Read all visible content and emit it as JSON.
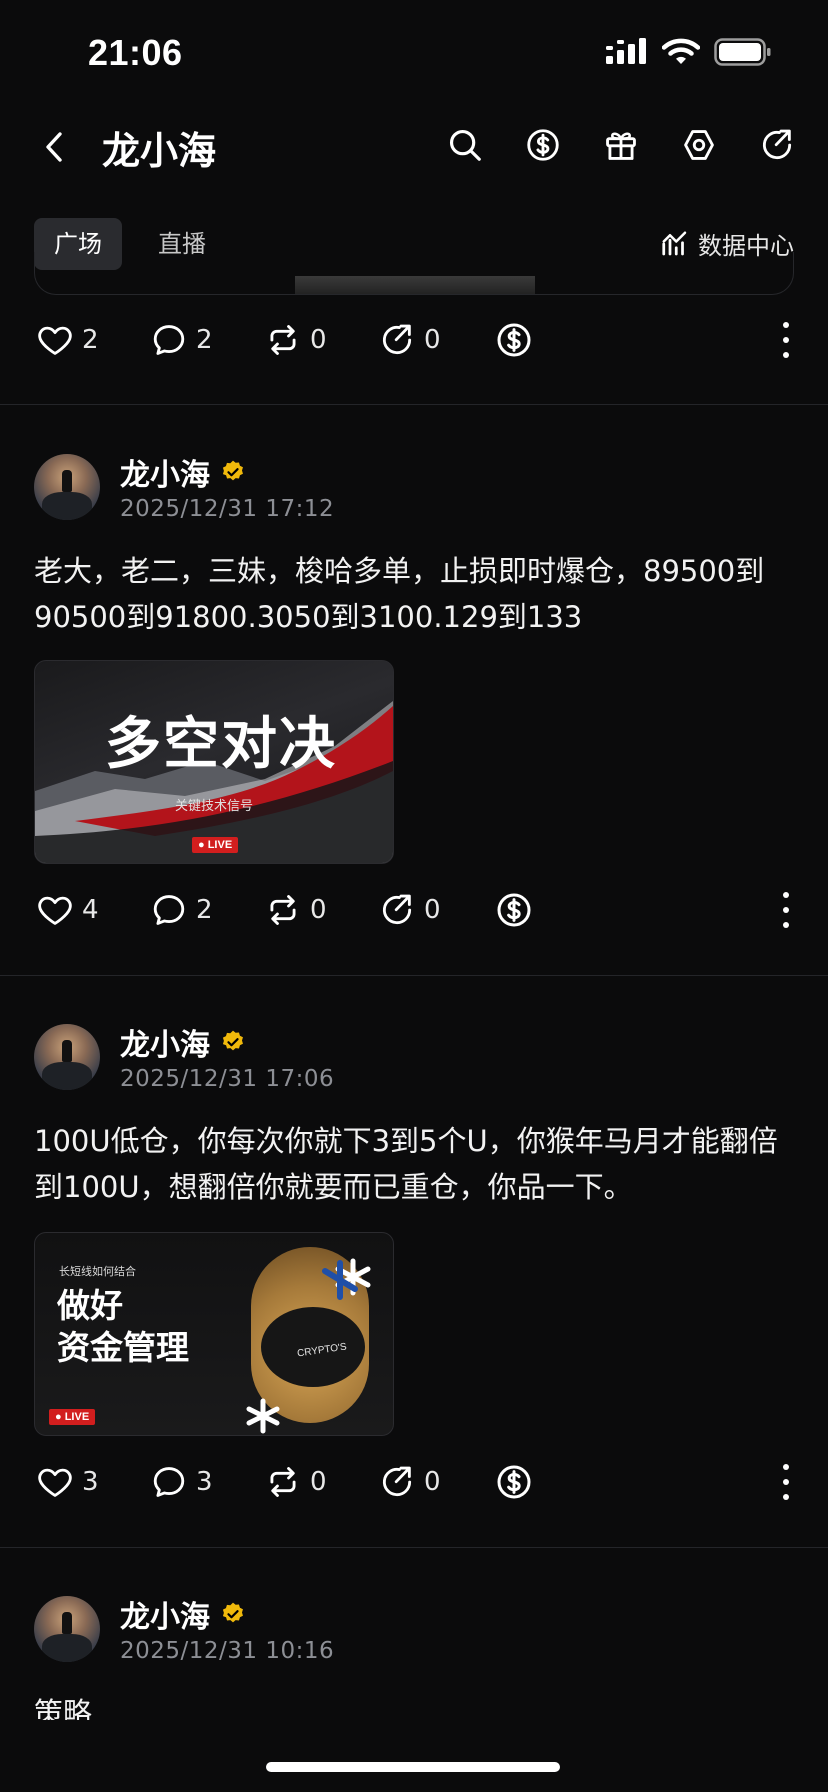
{
  "status_bar": {
    "time": "21:06"
  },
  "nav": {
    "title": "龙小海"
  },
  "tabs": [
    {
      "label": "广场",
      "active": true
    },
    {
      "label": "直播",
      "active": false
    }
  ],
  "data_center": {
    "label": "数据中心"
  },
  "prev_post": {
    "actions": {
      "likes": "2",
      "comments": "2",
      "reposts": "0",
      "shares": "0"
    }
  },
  "posts": [
    {
      "author": "龙小海",
      "time": "2025/12/31 17:12",
      "text": "老大，老二，三妹，梭哈多单，止损即时爆仓，89500到90500到91800.3050到3100.129到133",
      "thumbnail": {
        "title": "多空对决",
        "subtitle": "关键技术信号",
        "live_badge": "LIVE"
      },
      "actions": {
        "likes": "4",
        "comments": "2",
        "reposts": "0",
        "shares": "0"
      }
    },
    {
      "author": "龙小海",
      "time": "2025/12/31 17:06",
      "text": "100U低仓，你每次你就下3到5个U，你猴年马月才能翻倍到100U，想翻倍你就要而已重仓，你品一下。",
      "thumbnail": {
        "kicker": "长短线如何结合",
        "title_line1": "做好",
        "title_line2": "资金管理",
        "piggy_label": "CRYPTO'S",
        "live_badge": "LIVE"
      },
      "actions": {
        "likes": "3",
        "comments": "3",
        "reposts": "0",
        "shares": "0"
      }
    },
    {
      "author": "龙小海",
      "time": "2025/12/31 10:16",
      "text": "策略"
    }
  ],
  "colors": {
    "background": "#0b0b0c",
    "verified_badge": "#f0b90b",
    "live_badge": "#d21e1e",
    "muted_text": "#8d8f95"
  },
  "icons": [
    "back-icon",
    "search-icon",
    "tip-dollar-icon",
    "gift-icon",
    "settings-hex-icon",
    "share-icon",
    "chart-icon",
    "heart-icon",
    "comment-icon",
    "repost-icon",
    "share-arrow-icon",
    "dollar-icon",
    "more-icon",
    "verified-icon",
    "signal-icon",
    "wifi-icon",
    "battery-icon"
  ]
}
